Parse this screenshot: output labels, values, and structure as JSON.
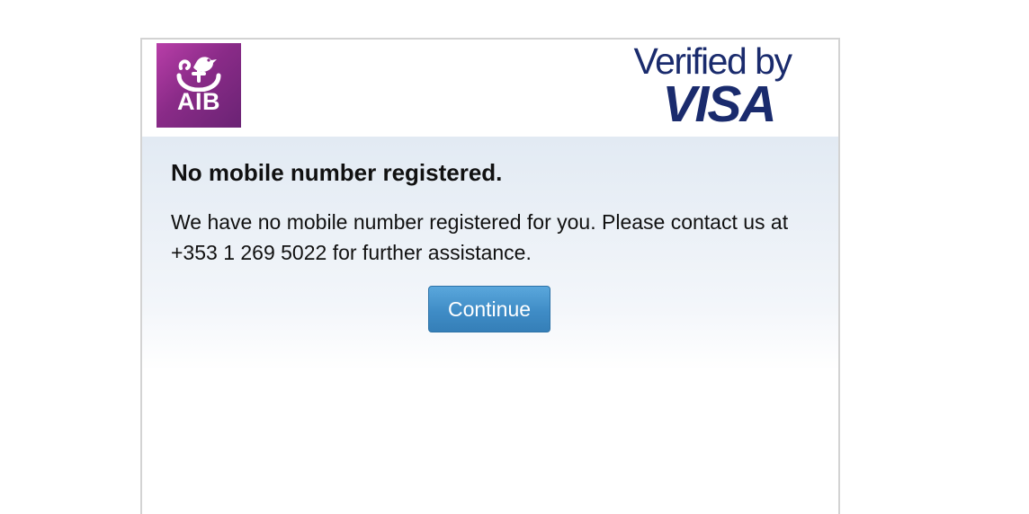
{
  "header": {
    "bank_logo_text": "AIB",
    "bank_logo_icon": "bird-emblem-icon",
    "scheme_logo_line1": "Verified by",
    "scheme_logo_line2": "VISA"
  },
  "dialog": {
    "title": "No mobile number registered.",
    "message": "We have no mobile number registered for you. Please contact us at +353 1 269 5022 for further assistance.",
    "continue_label": "Continue"
  },
  "colors": {
    "aib_purple": "#8a2b88",
    "visa_navy": "#1a2b6d",
    "button_blue": "#3f8cc6",
    "panel_tint": "#e2eaf3"
  }
}
